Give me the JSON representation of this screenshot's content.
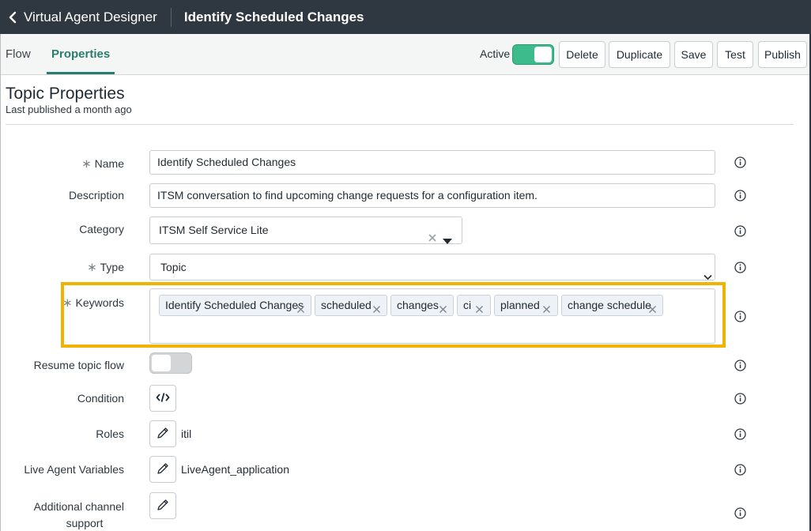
{
  "titlebar": {
    "app_title": "Virtual Agent Designer",
    "topic_title": "Identify Scheduled Changes"
  },
  "tabs": {
    "flow": "Flow",
    "properties": "Properties"
  },
  "toolbar": {
    "active_label": "Active",
    "active": true,
    "delete": "Delete",
    "duplicate": "Duplicate",
    "save": "Save",
    "test": "Test",
    "publish": "Publish"
  },
  "section": {
    "title": "Topic Properties",
    "subtitle": "Last published a month ago"
  },
  "form": {
    "required_mark": "∗",
    "name_label": "Name",
    "name_value": "Identify Scheduled Changes",
    "description_label": "Description",
    "description_value": "ITSM conversation to find upcoming change requests for a configuration item.",
    "category_label": "Category",
    "category_value": "ITSM Self Service Lite",
    "type_label": "Type",
    "type_value": "Topic",
    "keywords_label": "Keywords",
    "keywords": [
      "Identify Scheduled Changes",
      "scheduled",
      "changes",
      "ci",
      "planned",
      "change schedule"
    ],
    "resume_label": "Resume topic flow",
    "resume_on": false,
    "condition_label": "Condition",
    "roles_label": "Roles",
    "roles_value": "itil",
    "live_agent_label": "Live Agent Variables",
    "live_agent_value": "LiveAgent_application",
    "additional_label_line1": "Additional channel",
    "additional_label_line2": "support"
  },
  "colors": {
    "titlebar_bg": "#2f3840",
    "accent": "#2a7d6e",
    "toggle_on": "#3ebb8c",
    "highlight": "#f2b300"
  },
  "icons": {
    "back": "chevron-left-icon",
    "info": "info-icon",
    "clear": "close-icon",
    "dropdown": "caret-down-icon",
    "code": "code-icon",
    "edit": "pencil-icon"
  }
}
